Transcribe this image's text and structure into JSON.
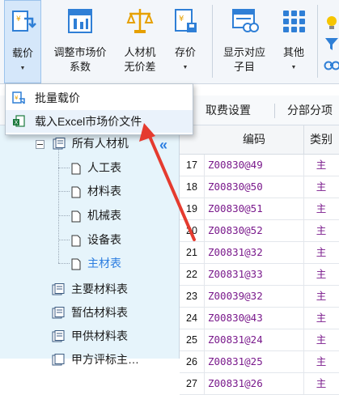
{
  "ribbon": {
    "buttons": [
      {
        "label": "载价",
        "icon": "load-price-icon",
        "has_arrow": true
      },
      {
        "label_line1": "调整市场价",
        "label_line2": "系数",
        "icon": "adjust-market-price-icon"
      },
      {
        "label_line1": "人材机",
        "label_line2": "无价差",
        "icon": "scale-balance-icon"
      },
      {
        "label": "存价",
        "icon": "save-price-icon",
        "has_arrow": true
      },
      {
        "label_line1": "显示对应",
        "label_line2": "子目",
        "icon": "show-subitem-icon"
      },
      {
        "label": "其他",
        "icon": "grid-apps-icon",
        "has_arrow": true
      }
    ]
  },
  "tabs": [
    {
      "label": "取费设置"
    },
    {
      "label": "分部分项"
    }
  ],
  "dropdown": {
    "items": [
      {
        "label": "批量载价",
        "icon": "batch-load-icon"
      },
      {
        "label": "载入Excel市场价文件",
        "icon": "excel-import-icon"
      }
    ]
  },
  "tree": {
    "root": "所有人材机",
    "children": [
      "人工表",
      "材料表",
      "机械表",
      "设备表",
      "主材表"
    ],
    "selected": "主材表",
    "others": [
      "主要材料表",
      "暂估材料表",
      "甲供材料表",
      "甲方评标主…"
    ]
  },
  "grid": {
    "headers": {
      "code": "编码",
      "type": "类别"
    },
    "rows": [
      {
        "no": "17",
        "code": "Z00830@49",
        "type": "主"
      },
      {
        "no": "18",
        "code": "Z00830@50",
        "type": "主"
      },
      {
        "no": "19",
        "code": "Z00830@51",
        "type": "主"
      },
      {
        "no": "20",
        "code": "Z00830@52",
        "type": "主"
      },
      {
        "no": "21",
        "code": "Z00831@32",
        "type": "主"
      },
      {
        "no": "22",
        "code": "Z00831@33",
        "type": "主"
      },
      {
        "no": "23",
        "code": "Z00039@32",
        "type": "主"
      },
      {
        "no": "24",
        "code": "Z00830@43",
        "type": "主"
      },
      {
        "no": "25",
        "code": "Z00831@24",
        "type": "主"
      },
      {
        "no": "26",
        "code": "Z00831@25",
        "type": "主"
      },
      {
        "no": "27",
        "code": "Z00831@26",
        "type": "主"
      }
    ]
  },
  "colors": {
    "accent": "#2b7de0",
    "code_purple": "#7a1a8c",
    "arrow_red": "#e53b2f",
    "tree_bg": "#e6f4fb"
  }
}
